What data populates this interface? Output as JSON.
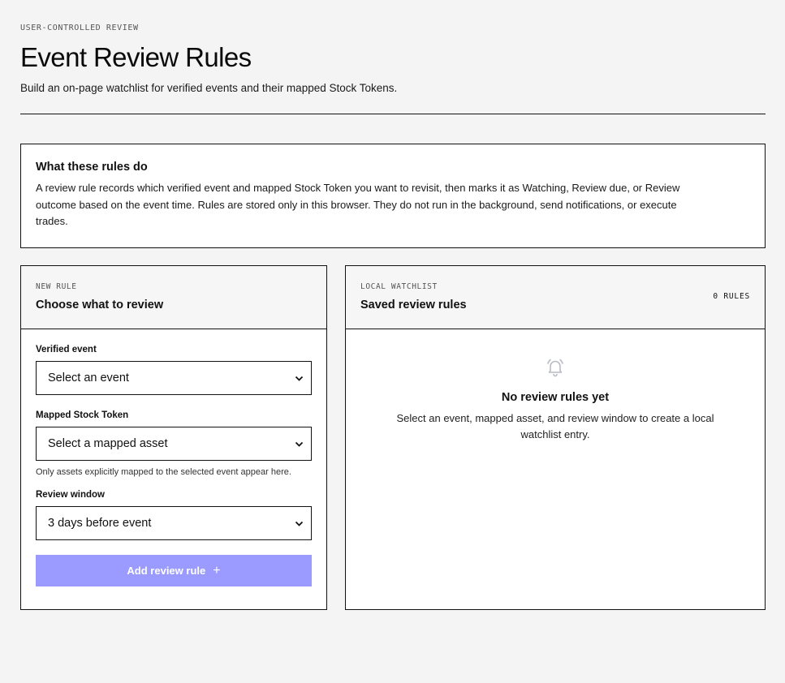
{
  "header": {
    "eyebrow": "USER-CONTROLLED REVIEW",
    "title": "Event Review Rules",
    "subtitle": "Build an on-page watchlist for verified events and their mapped Stock Tokens."
  },
  "info": {
    "title": "What these rules do",
    "body": "A review rule records which verified event and mapped Stock Token you want to revisit, then marks it as Watching, Review due, or Review outcome based on the event time. Rules are stored only in this browser. They do not run in the background, send notifications, or execute trades."
  },
  "new_rule": {
    "eyebrow": "NEW RULE",
    "title": "Choose what to review",
    "event_label": "Verified event",
    "event_value": "Select an event",
    "asset_label": "Mapped Stock Token",
    "asset_value": "Select a mapped asset",
    "asset_hint": "Only assets explicitly mapped to the selected event appear here.",
    "window_label": "Review window",
    "window_value": "3 days before event",
    "add_label": "Add review rule",
    "add_icon": "+"
  },
  "watchlist": {
    "eyebrow": "LOCAL WATCHLIST",
    "title": "Saved review rules",
    "count": "0 RULES",
    "empty_title": "No review rules yet",
    "empty_text": "Select an event, mapped asset, and review window to create a local watchlist entry."
  },
  "colors": {
    "accent_disabled": "#9b9bff",
    "background": "#f4f4f4"
  },
  "icons": {
    "select": "chevron-down-icon",
    "empty": "bell-icon"
  }
}
